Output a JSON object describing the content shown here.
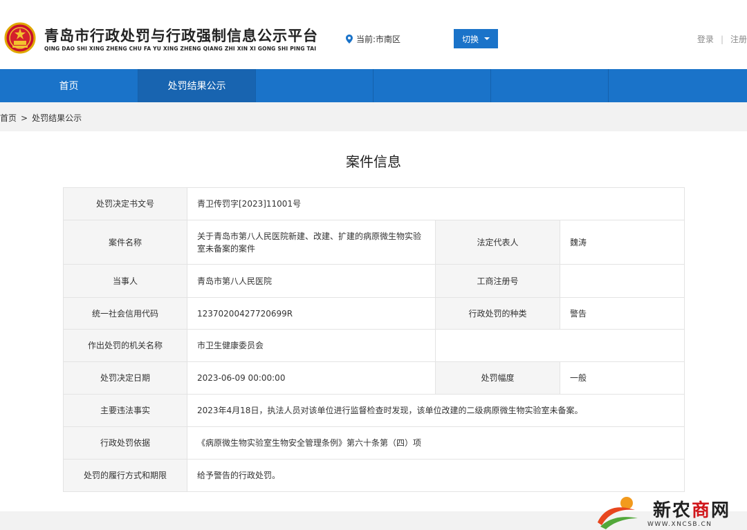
{
  "header": {
    "site_title": "青岛市行政处罚与行政强制信息公示平台",
    "site_pinyin": "QING DAO SHI XING ZHENG CHU FA YU XING ZHENG QIANG ZHI XIN XI GONG SHI PING TAI",
    "location": "当前:市南区",
    "switch_label": "切换",
    "login": "登录",
    "separator": "|",
    "register": "注册"
  },
  "nav": {
    "items": [
      {
        "label": "首页",
        "active": false
      },
      {
        "label": "处罚结果公示",
        "active": true
      },
      {
        "label": "",
        "active": false
      },
      {
        "label": "",
        "active": false
      },
      {
        "label": "",
        "active": false
      },
      {
        "label": "",
        "active": false
      }
    ]
  },
  "breadcrumb": {
    "home": "首页",
    "sep": ">",
    "current": "处罚结果公示"
  },
  "case": {
    "title": "案件信息",
    "doc_no_label": "处罚决定书文号",
    "doc_no": "青卫传罚字[2023]11001号",
    "case_name_label": "案件名称",
    "case_name": "关于青岛市第八人民医院新建、改建、扩建的病原微生物实验室未备案的案件",
    "legal_rep_label": "法定代表人",
    "legal_rep": "魏涛",
    "party_label": "当事人",
    "party": "青岛市第八人民医院",
    "biz_reg_label": "工商注册号",
    "biz_reg": "",
    "credit_code_label": "统一社会信用代码",
    "credit_code": "12370200427720699R",
    "penalty_type_label": "行政处罚的种类",
    "penalty_type": "警告",
    "authority_label": "作出处罚的机关名称",
    "authority": "市卫生健康委员会",
    "date_label": "处罚决定日期",
    "date": "2023-06-09 00:00:00",
    "range_label": "处罚幅度",
    "range": "一般",
    "facts_label": "主要违法事实",
    "facts": "2023年4月18日，执法人员对该单位进行监督检查时发现，该单位改建的二级病原微生物实验室未备案。",
    "basis_label": "行政处罚依据",
    "basis": "《病原微生物实验室生物安全管理条例》第六十条第（四）项",
    "method_label": "处罚的履行方式和期限",
    "method": "给予警告的行政处罚。"
  },
  "watermark": {
    "name_a": "新农",
    "name_b": "商",
    "name_c": "网",
    "url": "WWW.XNCSB.CN"
  },
  "colors": {
    "primary": "#1a73c9",
    "label_bg": "#f5f5f5",
    "watermark_red": "#d0161b"
  },
  "icons": [
    "national-emblem-icon",
    "location-pin-icon",
    "chevron-down-icon",
    "watermark-logo-icon"
  ]
}
